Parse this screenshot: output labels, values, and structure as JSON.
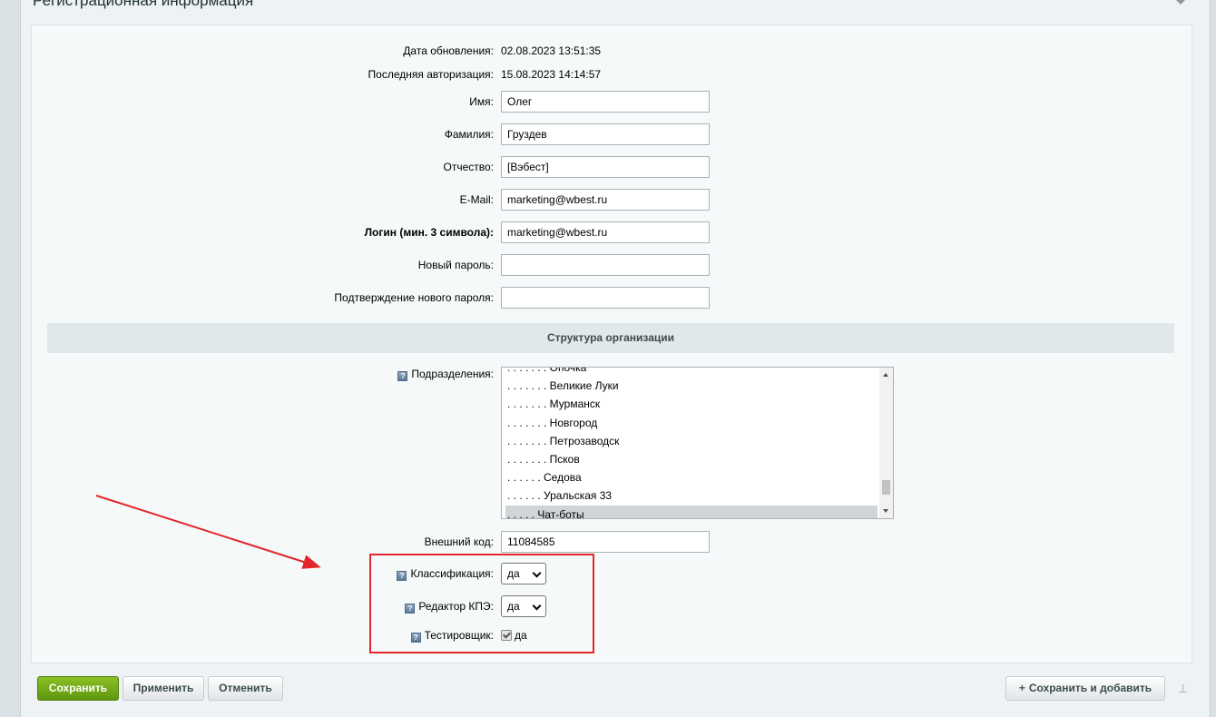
{
  "section": {
    "title": "Регистрационная информация"
  },
  "info": {
    "updated_label": "Дата обновления:",
    "updated_value": "02.08.2023 13:51:35",
    "last_login_label": "Последняя авторизация:",
    "last_login_value": "15.08.2023 14:14:57"
  },
  "fields": {
    "first_name": {
      "label": "Имя:",
      "value": "Олег"
    },
    "last_name": {
      "label": "Фамилия:",
      "value": "Груздев"
    },
    "middle_name": {
      "label": "Отчество:",
      "value": "[Вэбест]"
    },
    "email": {
      "label": "E-Mail:",
      "value": "marketing@wbest.ru"
    },
    "login": {
      "label": "Логин (мин. 3 символа):",
      "value": "marketing@wbest.ru"
    },
    "new_password": {
      "label": "Новый пароль:",
      "value": ""
    },
    "confirm_password": {
      "label": "Подтверждение нового пароля:",
      "value": ""
    }
  },
  "structure": {
    "header": "Структура организации",
    "departments_label": "Подразделения:",
    "departments": [
      ". . . . . . . Опочка",
      ". . . . . . . Великие Луки",
      ". . . . . . . Мурманск",
      ". . . . . . . Новгород",
      ". . . . . . . Петрозаводск",
      ". . . . . . . Псков",
      ". . . . . . Седова",
      ". . . . . . Уральская 33",
      ". . . . . Чат-боты"
    ],
    "selected_department": ". . . . . Чат-боты",
    "external_code_label": "Внешний код:",
    "external_code_value": "11084585",
    "classification_label": "Классификация:",
    "classification_value": "да",
    "kpe_editor_label": "Редактор КПЭ:",
    "kpe_editor_value": "да",
    "tester_label": "Тестировщик:",
    "tester_value": "да"
  },
  "highlight": {
    "color": "#e3262a"
  },
  "buttons": {
    "save": "Сохранить",
    "apply": "Применить",
    "cancel": "Отменить",
    "save_and_add": "Сохранить и добавить"
  },
  "colors": {
    "primary_green": "#6fa817",
    "header_bg": "#e0e8ea"
  }
}
